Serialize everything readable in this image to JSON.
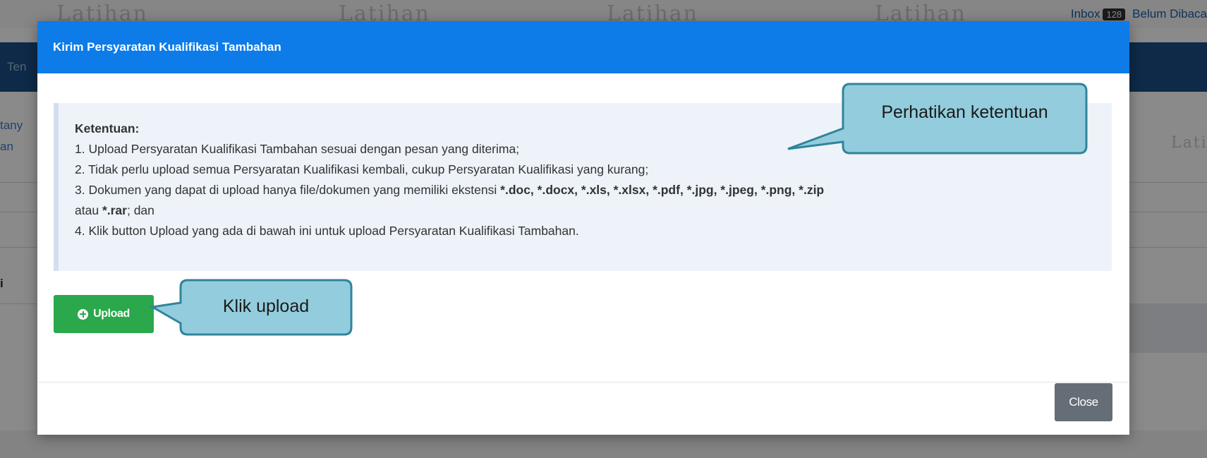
{
  "background": {
    "watermark": "Latihan",
    "inbox_label": "Inbox",
    "inbox_count": "128",
    "unread_label": "Belum Dibaca",
    "nav_fragment": "Ten",
    "side_fragment_1": "tany",
    "side_fragment_2": "an",
    "side_fragment_3": "i"
  },
  "modal": {
    "title": "Kirim Persyaratan Kualifikasi Tambahan",
    "info": {
      "heading": "Ketentuan:",
      "item1": "1. Upload Persyaratan Kualifikasi Tambahan sesuai dengan pesan yang diterima;",
      "item2": "2. Tidak perlu upload semua Persyaratan Kualifikasi kembali, cukup Persyaratan Kualifikasi yang kurang;",
      "item3_prefix": "3. Dokumen yang dapat di upload hanya file/dokumen yang memiliki ekstensi ",
      "item3_extensions": "*.doc, *.docx, *.xls, *.xlsx, *.pdf, *.jpg, *.jpeg, *.png, *.zip",
      "item3_atau": "atau ",
      "item3_rar": "*.rar",
      "item3_suffix": "; dan",
      "item4": "4. Klik button Upload yang ada di bawah ini untuk upload Persyaratan Kualifikasi Tambahan."
    },
    "upload_label": "Upload",
    "close_label": "Close"
  },
  "callouts": {
    "ketentuan": "Perhatikan ketentuan",
    "upload": "Klik upload"
  },
  "colors": {
    "header": "#0d7be8",
    "upload_button": "#2aa84b",
    "close_button": "#656d76",
    "callout_fill": "#93cddd",
    "callout_border": "#31849b"
  }
}
